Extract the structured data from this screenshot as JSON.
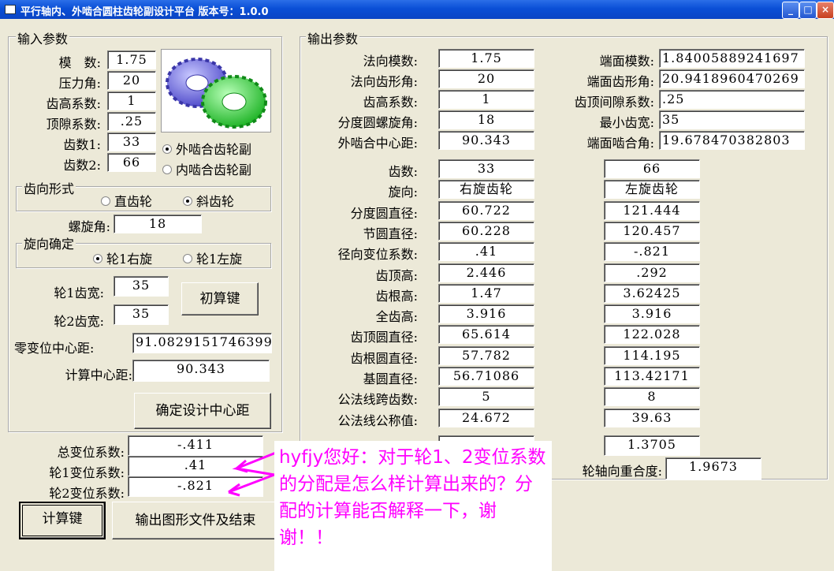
{
  "window": {
    "title": "平行轴内、外啮合圆柱齿轮副设计平台 版本号：1.0.0"
  },
  "input_group": {
    "title": "输入参数",
    "fields": [
      {
        "label": "模　数:",
        "value": "1.75"
      },
      {
        "label": "压力角:",
        "value": "20"
      },
      {
        "label": "齿高系数:",
        "value": "1"
      },
      {
        "label": "顶隙系数:",
        "value": ".25"
      },
      {
        "label": "齿数1:",
        "value": "33"
      },
      {
        "label": "齿数2:",
        "value": "66"
      }
    ],
    "mesh_options": [
      "外啮合齿轮副",
      "内啮合齿轮副"
    ],
    "mesh_selected": 0,
    "tooth_form": {
      "title": "齿向形式",
      "options": [
        "直齿轮",
        "斜齿轮"
      ],
      "selected": 1
    },
    "helix_label": "螺旋角:",
    "helix_value": "18",
    "direction": {
      "title": "旋向确定",
      "options": [
        "轮1右旋",
        "轮1左旋"
      ],
      "selected": 0
    },
    "width1_label": "轮1齿宽:",
    "width1_value": "35",
    "width2_label": "轮2齿宽:",
    "width2_value": "35",
    "init_button": "初算键",
    "zero_center_label": "零变位中心距:",
    "zero_center_value": "91.0829151746399",
    "calc_center_label": "计算中心距:",
    "calc_center_value": "90.343",
    "confirm_button": "确定设计中心距",
    "total_shift_label": "总变位系数:",
    "total_shift_value": "-.411",
    "shift1_label": "轮1变位系数:",
    "shift1_value": ".41",
    "shift2_label": "轮2变位系数:",
    "shift2_value": "-.821"
  },
  "buttons": {
    "calc": "计算键",
    "export": "输出图形文件及结束"
  },
  "output_group": {
    "title": "输出参数",
    "left_params": [
      {
        "label": "法向模数:",
        "value": "1.75"
      },
      {
        "label": "法向齿形角:",
        "value": "20"
      },
      {
        "label": "齿高系数:",
        "value": "1"
      },
      {
        "label": "分度圆螺旋角:",
        "value": "18"
      },
      {
        "label": "外啮合中心距:",
        "value": "90.343"
      }
    ],
    "right_params": [
      {
        "label": "端面模数:",
        "value": "1.84005889241697"
      },
      {
        "label": "端面齿形角:",
        "value": "20.9418960470269"
      },
      {
        "label": "齿顶间隙系数:",
        "value": ".25"
      },
      {
        "label": "最小齿宽:",
        "value": "35"
      },
      {
        "label": "端面啮合角:",
        "value": "19.678470382803"
      }
    ],
    "table": [
      {
        "label": "齿数:",
        "g1": "33",
        "g2": "66"
      },
      {
        "label": "旋向:",
        "g1": "右旋齿轮",
        "g2": "左旋齿轮"
      },
      {
        "label": "分度圆直径:",
        "g1": "60.722",
        "g2": "121.444"
      },
      {
        "label": "节圆直径:",
        "g1": "60.228",
        "g2": "120.457"
      },
      {
        "label": "径向变位系数:",
        "g1": ".41",
        "g2": "-.821"
      },
      {
        "label": "齿顶高:",
        "g1": "2.446",
        "g2": ".292"
      },
      {
        "label": "齿根高:",
        "g1": "1.47",
        "g2": "3.62425"
      },
      {
        "label": "全齿高:",
        "g1": "3.916",
        "g2": "3.916"
      },
      {
        "label": "齿顶圆直径:",
        "g1": "65.614",
        "g2": "122.028"
      },
      {
        "label": "齿根圆直径:",
        "g1": "57.782",
        "g2": "114.195"
      },
      {
        "label": "基圆直径:",
        "g1": "56.71086",
        "g2": "113.42171"
      },
      {
        "label": "公法线跨齿数:",
        "g1": "5",
        "g2": "8"
      },
      {
        "label": "公法线公称值:",
        "g1": "24.672",
        "g2": "39.63"
      }
    ],
    "end_contact_value": "1.3705",
    "axial_overlap_label": "轮轴向重合度:",
    "axial_overlap_value": "1.9673"
  },
  "note": {
    "text": "hyfjy您好：对于轮1、2变位系数的分配是怎么样计算出来的？分配的计算能否解释一下，谢谢！！"
  },
  "colors": {
    "title_bar": "#0a4fd6",
    "note_text": "#ff00ff",
    "window_bg": "#ece9d8"
  }
}
